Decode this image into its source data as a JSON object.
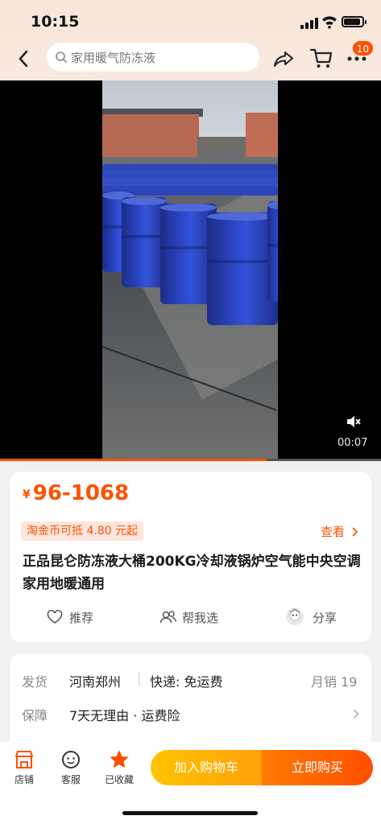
{
  "status_bar": {
    "time": "10:15"
  },
  "header": {
    "search_placeholder": "家用暖气防冻液",
    "cart_badge": "10",
    "icons": [
      "back-icon",
      "search-icon",
      "share-icon",
      "cart-icon",
      "more-icon"
    ]
  },
  "video": {
    "time": "00:07",
    "progress": 0.7
  },
  "product": {
    "currency": "¥",
    "price": "96-1068",
    "coin_text": "淘金币可抵 4.80 元起",
    "check_link": "查看",
    "title": "正品昆仑防冻液大桶200KG冷却液锅炉空气能中央空调家用地暖通用",
    "actions": [
      {
        "label": "推荐",
        "icon": "heart-icon"
      },
      {
        "label": "帮我选",
        "icon": "people-icon"
      },
      {
        "label": "分享",
        "icon": "avatar-icon"
      }
    ]
  },
  "shipping": {
    "ship_label": "发货",
    "ship_from": "河南郑州",
    "delivery": "快递: 免运费",
    "sales": "月销 19",
    "guarantee_label": "保障",
    "guarantee": "7天无理由 · 运费险"
  },
  "bottom_bar": {
    "store": "店铺",
    "service": "客服",
    "favorited": "已收藏",
    "add_to_cart": "加入购物车",
    "buy_now": "立即购买"
  },
  "colors": {
    "accent": "#ff5000",
    "cart_button": "#ffb400",
    "favorite_star": "#ff5000"
  }
}
